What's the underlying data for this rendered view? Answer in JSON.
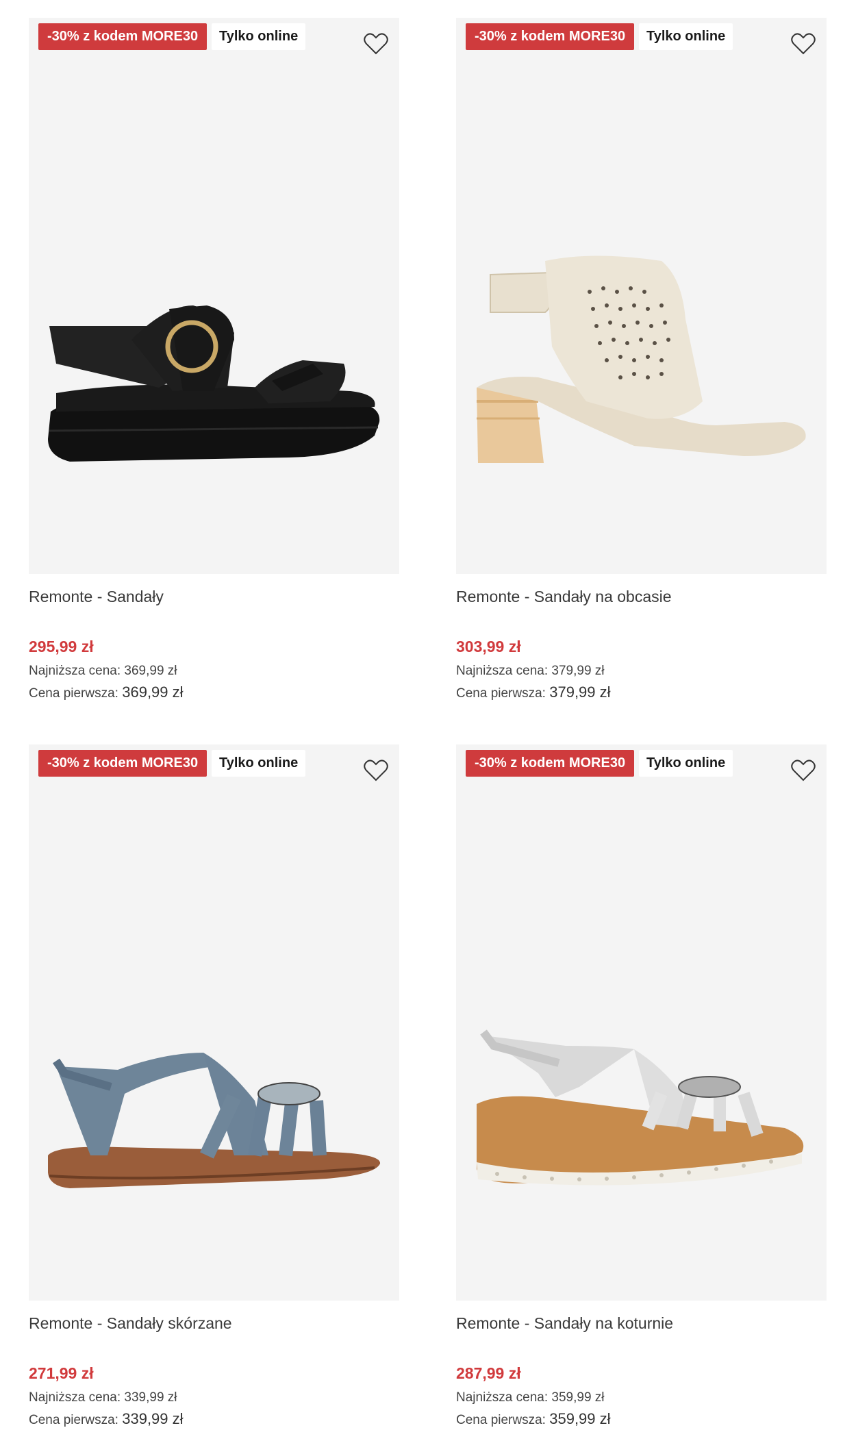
{
  "products": [
    {
      "promo_badge": "-30% z kodem MORE30",
      "online_badge": "Tylko online",
      "name": "Remonte - Sandały",
      "price": "295,99 zł",
      "lowest_label": "Najniższa cena:",
      "lowest_value": "369,99 zł",
      "first_label": "Cena pierwsza:",
      "first_value": "369,99 zł"
    },
    {
      "promo_badge": "-30% z kodem MORE30",
      "online_badge": "Tylko online",
      "name": "Remonte - Sandały na obcasie",
      "price": "303,99 zł",
      "lowest_label": "Najniższa cena:",
      "lowest_value": "379,99 zł",
      "first_label": "Cena pierwsza:",
      "first_value": "379,99 zł"
    },
    {
      "promo_badge": "-30% z kodem MORE30",
      "online_badge": "Tylko online",
      "name": "Remonte - Sandały skórzane",
      "price": "271,99 zł",
      "lowest_label": "Najniższa cena:",
      "lowest_value": "339,99 zł",
      "first_label": "Cena pierwsza:",
      "first_value": "339,99 zł"
    },
    {
      "promo_badge": "-30% z kodem MORE30",
      "online_badge": "Tylko online",
      "name": "Remonte - Sandały na koturnie",
      "price": "287,99 zł",
      "lowest_label": "Najniższa cena:",
      "lowest_value": "359,99 zł",
      "first_label": "Cena pierwsza:",
      "first_value": "359,99 zł"
    }
  ],
  "colors": {
    "promo_red": "#cf3b3d",
    "price_red": "#d13a3c",
    "image_bg": "#f4f4f4"
  },
  "icons": {
    "wishlist": "heart-icon"
  }
}
